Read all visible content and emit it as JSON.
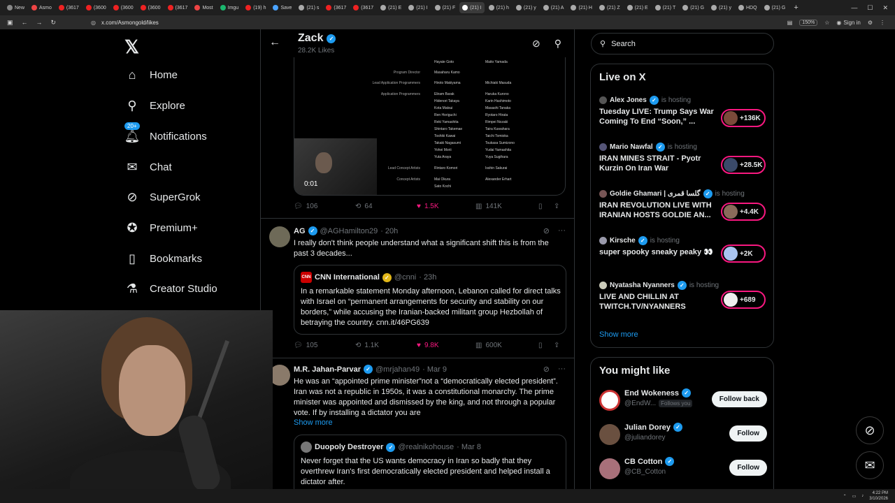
{
  "browser": {
    "tabs": [
      {
        "label": "New",
        "color": "#888"
      },
      {
        "label": "Asmo",
        "color": "#e44"
      },
      {
        "label": "(3617",
        "color": "#e22"
      },
      {
        "label": "(3600",
        "color": "#e22"
      },
      {
        "label": "(3600",
        "color": "#e22"
      },
      {
        "label": "(3600",
        "color": "#e22"
      },
      {
        "label": "(3617",
        "color": "#e22"
      },
      {
        "label": "Most",
        "color": "#e44"
      },
      {
        "label": "Imgu",
        "color": "#1bb76e"
      },
      {
        "label": "(19) h",
        "color": "#e22"
      },
      {
        "label": "Save",
        "color": "#4aa3ff"
      },
      {
        "label": "(21) s",
        "color": "#aaa"
      },
      {
        "label": "(3617",
        "color": "#e22"
      },
      {
        "label": "(3617",
        "color": "#e22"
      },
      {
        "label": "(21) E",
        "color": "#aaa"
      },
      {
        "label": "(21) I",
        "color": "#aaa"
      },
      {
        "label": "(21) F",
        "color": "#aaa"
      },
      {
        "label": "(21) I",
        "color": "#fff",
        "active": true
      },
      {
        "label": "(21) h",
        "color": "#aaa"
      },
      {
        "label": "(21) y",
        "color": "#aaa"
      },
      {
        "label": "(21) A",
        "color": "#aaa"
      },
      {
        "label": "(21) H",
        "color": "#aaa"
      },
      {
        "label": "(21) Z",
        "color": "#aaa"
      },
      {
        "label": "(21) E",
        "color": "#aaa"
      },
      {
        "label": "(21) T",
        "color": "#aaa"
      },
      {
        "label": "(21) G",
        "color": "#aaa"
      },
      {
        "label": "(21) y",
        "color": "#aaa"
      },
      {
        "label": "HDQ",
        "color": "#aaa"
      },
      {
        "label": "(21) G",
        "color": "#aaa"
      }
    ],
    "url": "x.com/Asmongold/likes",
    "zoom": "150%",
    "signin": "Sign in"
  },
  "nav": {
    "items": [
      {
        "label": "Home",
        "icon": "home-icon"
      },
      {
        "label": "Explore",
        "icon": "search-icon"
      },
      {
        "label": "Notifications",
        "icon": "bell-icon",
        "badge": "20+"
      },
      {
        "label": "Chat",
        "icon": "mail-icon"
      },
      {
        "label": "SuperGrok",
        "icon": "grok-icon"
      },
      {
        "label": "Premium+",
        "icon": "verified-icon"
      },
      {
        "label": "Bookmarks",
        "icon": "bookmark-icon"
      },
      {
        "label": "Creator Studio",
        "icon": "flask-icon"
      }
    ]
  },
  "header": {
    "title": "Zack",
    "subtitle": "28.2K Likes"
  },
  "video": {
    "time": "0:01",
    "credits": [
      {
        "role": "",
        "n1": "Hayate Goto",
        "n2": "Maito Yamada"
      },
      {
        "role": "Program Director",
        "n1": "Masaharu Kamo",
        "n2": ""
      },
      {
        "role": "Lead Application Programmers",
        "n1": "Hiroto Makiyama",
        "n2": "Michiaki Masuda"
      },
      {
        "role": "Application Programmers",
        "n1": "Eliram Barak",
        "n2": "Haruka Kurono"
      },
      {
        "role": "",
        "n1": "Hidenori Takaya",
        "n2": "Karin Hashimoto"
      },
      {
        "role": "",
        "n1": "Kota Matsui",
        "n2": "Masashi Tanaka"
      },
      {
        "role": "",
        "n1": "Ren Horiguchi",
        "n2": "Ryotaro Hirata"
      },
      {
        "role": "",
        "n1": "Reki Yamashita",
        "n2": "Rimpei Nozaki"
      },
      {
        "role": "",
        "n1": "Shintaro Takemae",
        "n2": "Taira Kuwahara"
      },
      {
        "role": "",
        "n1": "Toshiki Kawai",
        "n2": "Taichi Tomioka"
      },
      {
        "role": "",
        "n1": "Takaki Nagasumi",
        "n2": "Tsukasa Sumizono"
      },
      {
        "role": "",
        "n1": "Yohei Morii",
        "n2": "Yudai Yamashita"
      },
      {
        "role": "",
        "n1": "Yuta Araya",
        "n2": "Yuya Sugihara"
      },
      {
        "role": "Lead Concept Artists",
        "n1": "Rintaro Komori",
        "n2": "Isshin Sakurai"
      },
      {
        "role": "Concept Artists",
        "n1": "Mai Okura",
        "n2": "Alexander Erhart"
      },
      {
        "role": "",
        "n1": "Sato Kochi",
        "n2": ""
      },
      {
        "role": "Lead Character Artist",
        "n1": "Wilson Ono",
        "n2": ""
      }
    ]
  },
  "tweet1_actions": {
    "replies": "106",
    "reposts": "64",
    "likes": "1.5K",
    "views": "141K"
  },
  "tweet2": {
    "name": "AG",
    "handle": "@AGHamilton29",
    "time": "· 20h",
    "text": "I really don't think people understand what a significant shift this is from the past 3 decades...",
    "quote": {
      "name": "CNN International",
      "handle": "@cnni",
      "time": "· 23h",
      "logo": "CNN",
      "text": "In a remarkable statement Monday afternoon, Lebanon called for direct talks with Israel on “permanent arrangements for security and stability on our borders,” while accusing the Iranian-backed militant group Hezbollah of betraying the country. cnn.it/46PG639"
    },
    "actions": {
      "replies": "105",
      "reposts": "1.1K",
      "likes": "9.8K",
      "views": "600K"
    }
  },
  "tweet3": {
    "name": "M.R. Jahan-Parvar",
    "handle": "@mrjahan49",
    "time": "· Mar 9",
    "text": "He was an “appointed prime minister”not a “democratically elected president”. Iran was not a republic in 1950s, it was a constitutional monarchy. The prime minister was appointed and dismissed by the king, and not through a popular vote. If by installing a dictator you are",
    "show_more": "Show more",
    "quote": {
      "name": "Duopoly Destroyer",
      "handle": "@realnikohouse",
      "time": "· Mar 8",
      "text": "Never forget that the US wants democracy in Iran so badly that they overthrew Iran's first democratically elected president and helped install a dictator after."
    }
  },
  "search": {
    "placeholder": "Search"
  },
  "live": {
    "title": "Live on X",
    "is_hosting": "is hosting",
    "items": [
      {
        "host": "Alex Jones",
        "title": "Tuesday LIVE: Trump Says War Coming To End “Soon,” ...",
        "count": "+136K"
      },
      {
        "host": "Mario Nawfal",
        "title": "IRAN MINES STRAIT - Pyotr Kurzin On Iran War",
        "count": "+28.5K"
      },
      {
        "host": "Goldie Ghamari | گلسا قمری",
        "title": "IRAN REVOLUTION LIVE WITH IRANIAN HOSTS GOLDIE AN...",
        "count": "+4.4K"
      },
      {
        "host": "Kirsche",
        "title": "super spooky sneaky peaky 👀",
        "count": "+2K"
      },
      {
        "host": "Nyatasha Nyanners",
        "title": "LIVE AND CHILLIN AT TWITCH.TV/NYANNERS",
        "count": "+689"
      }
    ],
    "show_more": "Show more"
  },
  "suggest": {
    "title": "You might like",
    "items": [
      {
        "name": "End Wokeness",
        "handle": "@EndW...",
        "follows_you": "Follows you",
        "button": "Follow back"
      },
      {
        "name": "Julian Dorey",
        "handle": "@juliandorey",
        "button": "Follow"
      },
      {
        "name": "CB Cotton",
        "handle": "@CB_Cotton",
        "button": "Follow"
      }
    ]
  },
  "taskbar": {
    "time": "4:22 PM",
    "date": "3/10/2026"
  },
  "colors": {
    "accent": "#1d9bf0",
    "like": "#f91880",
    "border": "#2f3336",
    "muted": "#71767b"
  }
}
